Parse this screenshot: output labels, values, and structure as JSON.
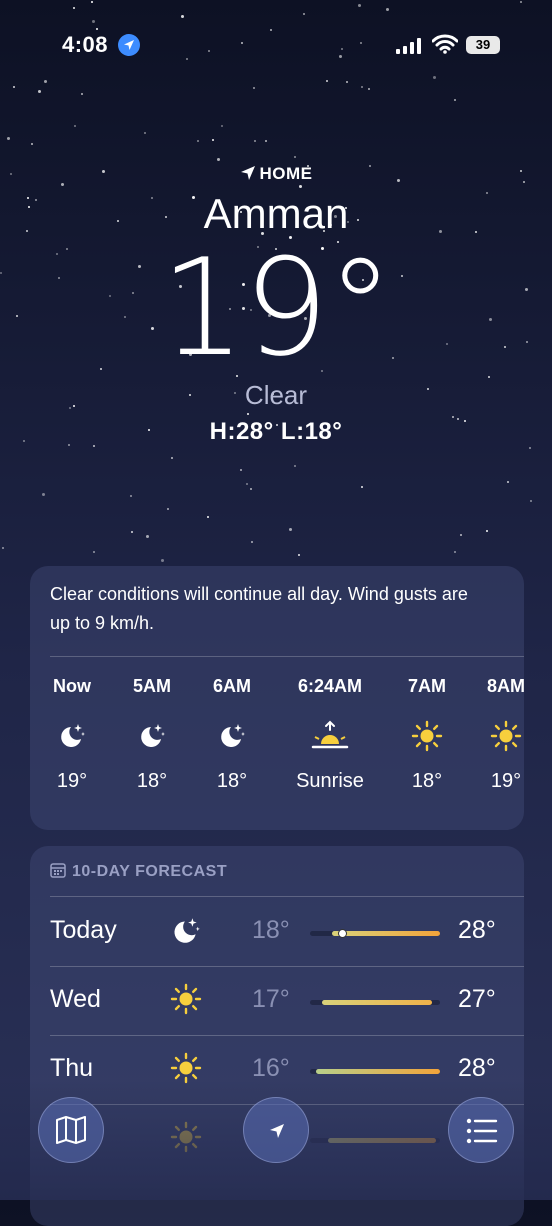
{
  "status_bar": {
    "time": "4:08",
    "battery": "39"
  },
  "header": {
    "location_tag": "HOME",
    "city": "Amman",
    "temperature": "19°",
    "condition": "Clear",
    "high_low": "H:28°  L:18°"
  },
  "hourly": {
    "summary": "Clear conditions will continue all day. Wind gusts are up to 9 km/h.",
    "items": [
      {
        "label": "Now",
        "icon": "moon-stars-icon",
        "value": "19°"
      },
      {
        "label": "5AM",
        "icon": "moon-stars-icon",
        "value": "18°"
      },
      {
        "label": "6AM",
        "icon": "moon-stars-icon",
        "value": "18°"
      },
      {
        "label": "6:24AM",
        "icon": "sunrise-icon",
        "value": "Sunrise"
      },
      {
        "label": "7AM",
        "icon": "sun-icon",
        "value": "18°"
      },
      {
        "label": "8AM",
        "icon": "sun-icon",
        "value": "19°"
      }
    ]
  },
  "forecast": {
    "title": "10-DAY FORECAST",
    "days": [
      {
        "day": "Today",
        "icon": "moon-stars-icon",
        "low": "18°",
        "high": "28°"
      },
      {
        "day": "Wed",
        "icon": "sun-icon",
        "low": "17°",
        "high": "27°"
      },
      {
        "day": "Thu",
        "icon": "sun-icon",
        "low": "16°",
        "high": "28°"
      }
    ]
  },
  "colors": {
    "accent": "#3d8cff",
    "sun": "#f7cf3d",
    "bar_warm": "#f2a33a",
    "bar_mild": "#d9d27a"
  }
}
